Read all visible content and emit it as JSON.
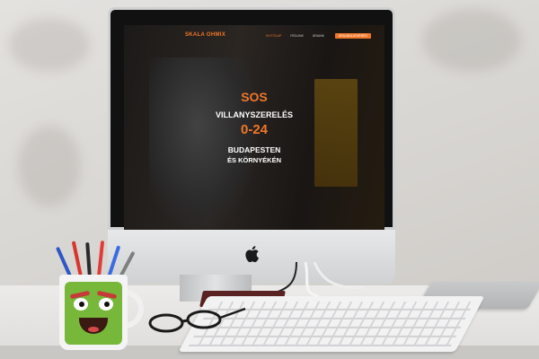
{
  "website": {
    "logo": "SKALA OHMIX",
    "nav": [
      "NYITÓLAP",
      "RÓLUNK",
      "ÁRAINK"
    ],
    "cta": "ÁRAJÁNLATKÉRÉS"
  },
  "hero": {
    "sos": "SOS",
    "line1": "VILLANYSZERELÉS",
    "hours": "0-24",
    "line2": "BUDAPESTEN",
    "line3": "ÉS KÖRNYÉKÉN"
  },
  "colors": {
    "accent": "#f0772a",
    "headline": "#ffffff",
    "mug_green": "#77b83a"
  }
}
